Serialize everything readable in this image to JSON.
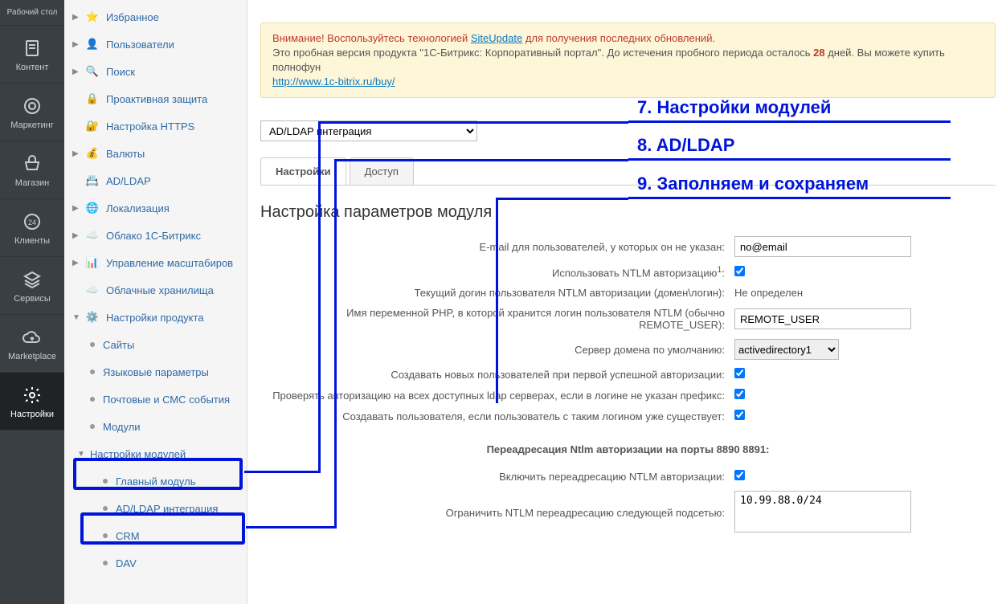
{
  "rail": [
    {
      "key": "desktop",
      "label": "Рабочий стол"
    },
    {
      "key": "content",
      "label": "Контент"
    },
    {
      "key": "marketing",
      "label": "Маркетинг"
    },
    {
      "key": "shop",
      "label": "Магазин"
    },
    {
      "key": "clients",
      "label": "Клиенты"
    },
    {
      "key": "services",
      "label": "Сервисы"
    },
    {
      "key": "marketplace",
      "label": "Marketplace"
    },
    {
      "key": "settings",
      "label": "Настройки"
    }
  ],
  "nav": {
    "items": [
      {
        "label": "Избранное",
        "icon": "star",
        "arrow": "▶"
      },
      {
        "label": "Пользователи",
        "icon": "user",
        "arrow": "▶"
      },
      {
        "label": "Поиск",
        "icon": "search",
        "arrow": "▶"
      },
      {
        "label": "Проактивная защита",
        "icon": "lock",
        "arrow": ""
      },
      {
        "label": "Настройка HTTPS",
        "icon": "lock-blue",
        "arrow": ""
      },
      {
        "label": "Валюты",
        "icon": "coin",
        "arrow": "▶"
      },
      {
        "label": "AD/LDAP",
        "icon": "ldap",
        "arrow": ""
      },
      {
        "label": "Локализация",
        "icon": "globe",
        "arrow": "▶"
      },
      {
        "label": "Облако 1С-Битрикс",
        "icon": "cloud",
        "arrow": "▶"
      },
      {
        "label": "Управление масштабиров",
        "icon": "scale",
        "arrow": "▶"
      },
      {
        "label": "Облачные хранилища",
        "icon": "cloud2",
        "arrow": ""
      },
      {
        "label": "Настройки продукта",
        "icon": "gear",
        "arrow": "▼"
      }
    ],
    "product_sub": [
      {
        "label": "Сайты"
      },
      {
        "label": "Языковые параметры"
      },
      {
        "label": "Почтовые и СМС события"
      },
      {
        "label": "Модули"
      },
      {
        "label": "Настройки модулей",
        "arrow": "▼",
        "hl": true
      }
    ],
    "module_sub": [
      {
        "label": "Главный модуль"
      },
      {
        "label": "AD/LDAP интеграция",
        "hl": true
      },
      {
        "label": "CRM"
      },
      {
        "label": "DAV"
      }
    ]
  },
  "alert": {
    "warn": "Внимание! Воспользуйтесь технологией ",
    "link1": "SiteUpdate",
    "warn2": " для получения последних обновлений.",
    "trial": "Это пробная версия продукта \"1С-Битрикс: Корпоративный портал\". До истечения пробного периода осталось ",
    "days": "28",
    "trial2": " дней. Вы можете купить полнофун",
    "link2": "http://www.1c-bitrix.ru/buy/"
  },
  "select_value": "AD/LDAP интеграция",
  "tabs": [
    {
      "label": "Настройки"
    },
    {
      "label": "Доступ"
    }
  ],
  "section": "Настройка параметров модуля",
  "form": {
    "email_label": "E-mail для пользователей, у которых он не указан:",
    "email_value": "no@email",
    "ntlm_label": "Использовать NTLM авторизацию",
    "ntlm_sup": "1",
    "ntlm_sup_colon": ":",
    "current_login_label": "Текущий догин пользователя NTLM авторизации (домен\\логин):",
    "current_login_value": "Не определен",
    "php_var_label": "Имя переменной PHP, в которой хранится логин пользователя NTLM (обычно REMOTE_USER):",
    "php_var_value": "REMOTE_USER",
    "server_label": "Сервер домена по умолчанию:",
    "server_value": "activedirectory1",
    "create_label": "Создавать новых пользователей при первой успешной авторизации:",
    "check_label": "Проверять авторизацию на всех доступных ldap серверах, если в логине не указан префикс:",
    "create2_label": "Создавать пользователя, если пользователь с таким логином уже существует:",
    "sub_head": "Переадресация Ntlm авторизации на порты 8890 8891:",
    "redirect_label": "Включить переадресацию NTLM авторизации:",
    "subnet_label": "Ограничить NTLM переадресацию следующей подсетью:",
    "subnet_value": "10.99.88.0/24"
  },
  "annot": {
    "a7": "7. Настройки модулей",
    "a8": "8. AD/LDAP",
    "a9": "9. Заполняем и сохраняем"
  }
}
